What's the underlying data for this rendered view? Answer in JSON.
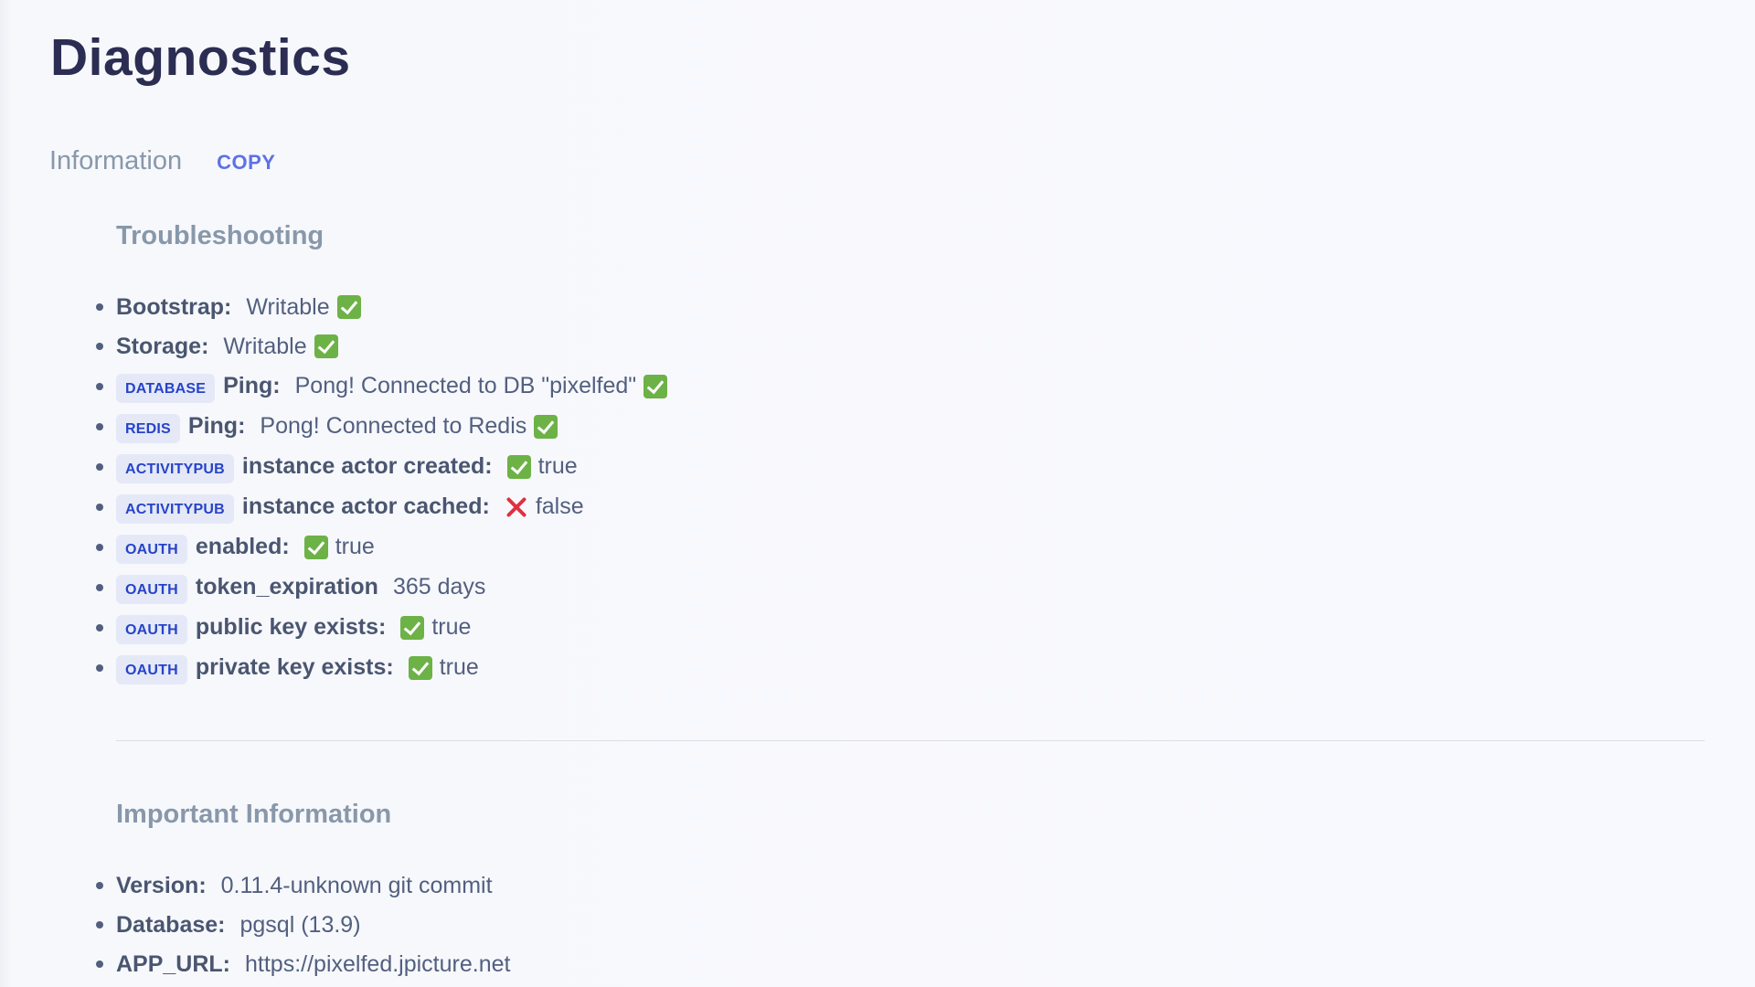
{
  "page": {
    "title": "Diagnostics"
  },
  "info": {
    "label": "Information",
    "copy_label": "COPY"
  },
  "troubleshooting": {
    "title": "Troubleshooting",
    "items": {
      "bootstrap": {
        "key": "Bootstrap:",
        "value": "Writable",
        "status": "check"
      },
      "storage": {
        "key": "Storage:",
        "value": "Writable",
        "status": "check"
      },
      "database": {
        "badge": "DATABASE",
        "key": "Ping:",
        "value": "Pong! Connected to DB \"pixelfed\"",
        "status": "check"
      },
      "redis": {
        "badge": "REDIS",
        "key": "Ping:",
        "value": "Pong! Connected to Redis",
        "status": "check"
      },
      "ap_created": {
        "badge": "ACTIVITYPUB",
        "key": "instance actor created:",
        "value": "true",
        "status": "check"
      },
      "ap_cached": {
        "badge": "ACTIVITYPUB",
        "key": "instance actor cached:",
        "value": "false",
        "status": "cross"
      },
      "oauth_enabled": {
        "badge": "OAUTH",
        "key": "enabled:",
        "value": "true",
        "status": "check"
      },
      "oauth_token": {
        "badge": "OAUTH",
        "key": "token_expiration",
        "value": "365 days"
      },
      "oauth_public": {
        "badge": "OAUTH",
        "key": "public key exists:",
        "value": "true",
        "status": "check"
      },
      "oauth_private": {
        "badge": "OAUTH",
        "key": "private key exists:",
        "value": "true",
        "status": "check"
      }
    }
  },
  "important": {
    "title": "Important Information",
    "items": {
      "version": {
        "key": "Version:",
        "value": "0.11.4-unknown git commit"
      },
      "database": {
        "key": "Database:",
        "value": "pgsql (13.9)"
      },
      "app_url": {
        "key": "APP_URL:",
        "value": "https://pixelfed.jpicture.net"
      }
    }
  },
  "colors": {
    "title": "#2b2d52",
    "muted_heading": "#8898aa",
    "link": "#5e72e4",
    "badge_bg": "#e5e9f7",
    "badge_text": "#2643c9",
    "check_green": "#6db247",
    "cross_red": "#e0303f"
  }
}
